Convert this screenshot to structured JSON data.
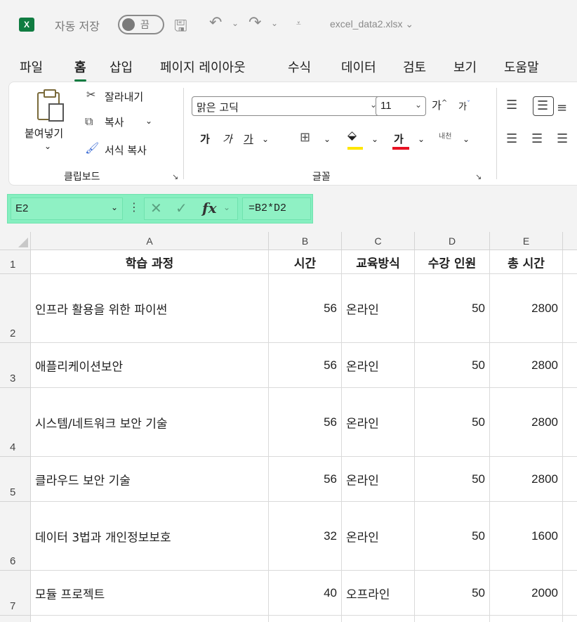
{
  "titlebar": {
    "app_badge": "X",
    "autosave_label": "자동 저장",
    "autosave_toggle": "끔",
    "filename": "excel_data2.xlsx"
  },
  "menu": [
    "파일",
    "홈",
    "삽입",
    "페이지 레이아웃",
    "수식",
    "데이터",
    "검토",
    "보기",
    "도움말"
  ],
  "ribbon": {
    "clipboard": {
      "paste": "붙여넣기",
      "cut": "잘라내기",
      "copy": "복사",
      "format_painter": "서식 복사",
      "group_label": "클립보드"
    },
    "font": {
      "font_name": "맑은 고딕",
      "font_size": "11",
      "grow": "가",
      "shrink": "가",
      "bold": "가",
      "italic": "가",
      "underline": "가",
      "font_color": "가",
      "phonetic": "내천",
      "group_label": "글꼴",
      "highlight_color": "#ffe600",
      "font_color_swatch": "#e81123"
    }
  },
  "formula_bar": {
    "name_box": "E2",
    "fx": "fx",
    "formula": "=B2*D2"
  },
  "sheet": {
    "columns": [
      "A",
      "B",
      "C",
      "D",
      "E"
    ],
    "header_row": {
      "row": "1",
      "a": "학습 과정",
      "b": "시간",
      "c": "교육방식",
      "d": "수강 인원",
      "e": "총 시간"
    },
    "rows": [
      {
        "row": "2",
        "a": "인프라 활용을 위한 파이썬",
        "b": "56",
        "c": "온라인",
        "d": "50",
        "e": "2800"
      },
      {
        "row": "3",
        "a": "애플리케이션보안",
        "b": "56",
        "c": "온라인",
        "d": "50",
        "e": "2800"
      },
      {
        "row": "4",
        "a": "시스템/네트워크 보안 기술",
        "b": "56",
        "c": "온라인",
        "d": "50",
        "e": "2800"
      },
      {
        "row": "5",
        "a": "클라우드 보안 기술",
        "b": "56",
        "c": "온라인",
        "d": "50",
        "e": "2800"
      },
      {
        "row": "6",
        "a": "데이터 3법과 개인정보보호",
        "b": "32",
        "c": "온라인",
        "d": "50",
        "e": "1600"
      },
      {
        "row": "7",
        "a": "모듈 프로젝트",
        "b": "40",
        "c": "오프라인",
        "d": "50",
        "e": "2000"
      }
    ]
  }
}
